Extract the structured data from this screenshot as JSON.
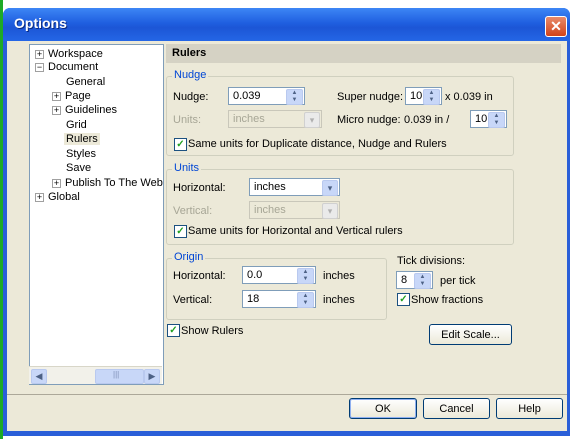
{
  "window": {
    "title": "Options",
    "close_glyph": "✕"
  },
  "tree": {
    "items": [
      {
        "label": "Workspace",
        "exp": "+"
      },
      {
        "label": "Document",
        "exp": "−"
      },
      {
        "label": "General"
      },
      {
        "label": "Page",
        "exp": "+"
      },
      {
        "label": "Guidelines",
        "exp": "+"
      },
      {
        "label": "Grid"
      },
      {
        "label": "Rulers"
      },
      {
        "label": "Styles"
      },
      {
        "label": "Save"
      },
      {
        "label": "Publish To The Web",
        "exp": "+"
      },
      {
        "label": "Global",
        "exp": "+"
      }
    ],
    "scroll_thumb_glyph": "|||"
  },
  "panel": {
    "header": "Rulers"
  },
  "nudge": {
    "group_title": "Nudge",
    "nudge_label": "Nudge:",
    "nudge_value": "0.039",
    "super_label": "Super nudge:",
    "super_value": "10",
    "super_suffix": "x 0.039 in",
    "units_label": "Units:",
    "units_value": "inches",
    "micro_label": "Micro nudge:",
    "micro_prefix": "0.039 in /",
    "micro_value": "10",
    "same_units_label": "Same units for Duplicate distance, Nudge and Rulers"
  },
  "units": {
    "group_title": "Units",
    "horizontal_label": "Horizontal:",
    "horizontal_value": "inches",
    "vertical_label": "Vertical:",
    "vertical_value": "inches",
    "same_units_label": "Same units for Horizontal and Vertical rulers"
  },
  "origin": {
    "group_title": "Origin",
    "horizontal_label": "Horizontal:",
    "horizontal_value": "0.0",
    "horizontal_unit": "inches",
    "vertical_label": "Vertical:",
    "vertical_value": "18",
    "vertical_unit": "inches"
  },
  "tick": {
    "label": "Tick divisions:",
    "value": "8",
    "suffix": "per tick",
    "show_fractions_label": "Show fractions"
  },
  "show_rulers_label": "Show Rulers",
  "edit_scale_label": "Edit Scale...",
  "buttons": {
    "ok": "OK",
    "cancel": "Cancel",
    "help": "Help"
  },
  "icons": {
    "check": "✓",
    "spin_up": "▲",
    "spin_down": "▼",
    "dropdown": "▾",
    "scroll_left": "◀",
    "scroll_right": "▶"
  }
}
